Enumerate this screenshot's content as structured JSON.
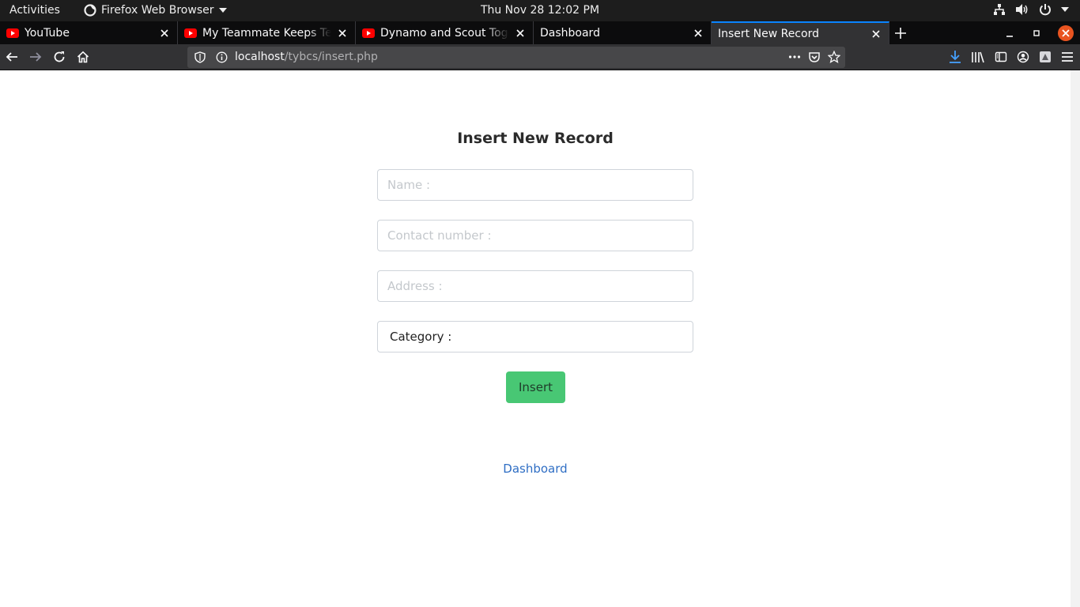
{
  "system": {
    "activities": "Activities",
    "app_menu": "Firefox Web Browser",
    "clock": "Thu Nov 28  12:02 PM"
  },
  "tabs": [
    {
      "label": "YouTube",
      "favicon": "youtube-icon"
    },
    {
      "label": "My Teammate Keeps Tell",
      "favicon": "youtube-icon"
    },
    {
      "label": "Dynamo and Scout Toget",
      "favicon": "youtube-icon"
    },
    {
      "label": "Dashboard",
      "favicon": ""
    },
    {
      "label": "Insert New Record",
      "favicon": "",
      "active": true
    }
  ],
  "urlbar": {
    "host": "localhost",
    "path": "/tybcs/insert.php"
  },
  "colors": {
    "accent": "#0a84ff",
    "insert_button": "#48c774",
    "link": "#2f6ec4",
    "close_window": "#e95420"
  },
  "form": {
    "title": "Insert New Record",
    "name_placeholder": "Name :",
    "contact_placeholder": "Contact number :",
    "address_placeholder": "Address :",
    "category_label": "Category :",
    "submit_label": "Insert"
  },
  "footer": {
    "dashboard_link": "Dashboard"
  }
}
